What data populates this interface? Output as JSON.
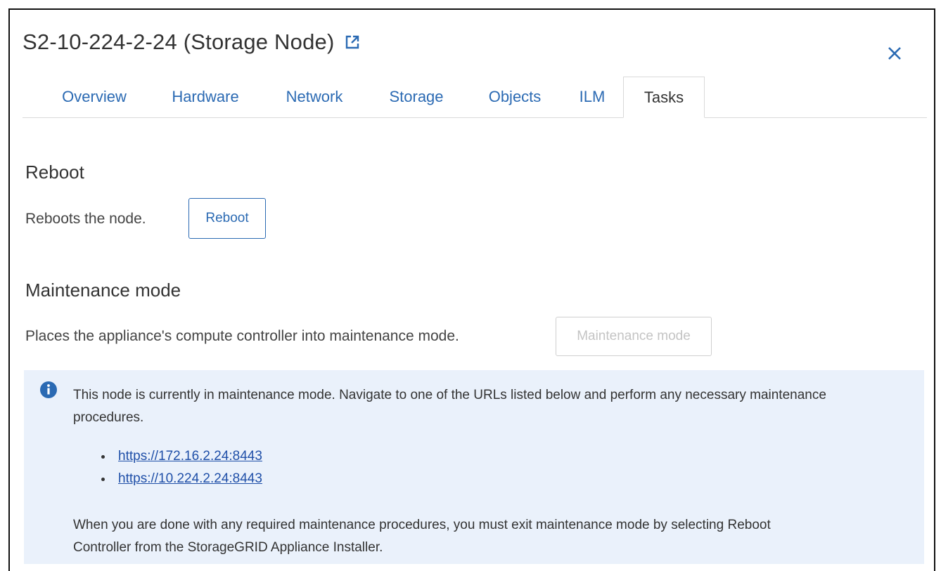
{
  "dialog": {
    "title": "S2-10-224-2-24 (Storage Node)",
    "external_link_icon": "external-link-icon",
    "close_icon": "close-icon"
  },
  "tabs": [
    {
      "label": "Overview",
      "active": false
    },
    {
      "label": "Hardware",
      "active": false
    },
    {
      "label": "Network",
      "active": false
    },
    {
      "label": "Storage",
      "active": false
    },
    {
      "label": "Objects",
      "active": false
    },
    {
      "label": "ILM",
      "active": false
    },
    {
      "label": "Tasks",
      "active": true
    }
  ],
  "reboot": {
    "heading": "Reboot",
    "description": "Reboots the node.",
    "button_label": "Reboot"
  },
  "maintenance": {
    "heading": "Maintenance mode",
    "description": "Places the appliance's compute controller into maintenance mode.",
    "button_label": "Maintenance mode",
    "button_disabled": true
  },
  "info_box": {
    "icon": "info-icon",
    "message_line1": "This node is currently in maintenance mode. Navigate to one of the URLs listed below and perform any necessary maintenance",
    "message_line2": "procedures.",
    "urls": [
      "https://172.16.2.24:8443",
      "https://10.224.2.24:8443"
    ],
    "footer_line1": "When you are done with any required maintenance procedures, you must exit maintenance mode by selecting Reboot",
    "footer_line2": "Controller from the StorageGRID Appliance Installer."
  },
  "colors": {
    "accent": "#2b6ab3",
    "info_background": "#eaf1fb",
    "link": "#1f4fa8"
  }
}
